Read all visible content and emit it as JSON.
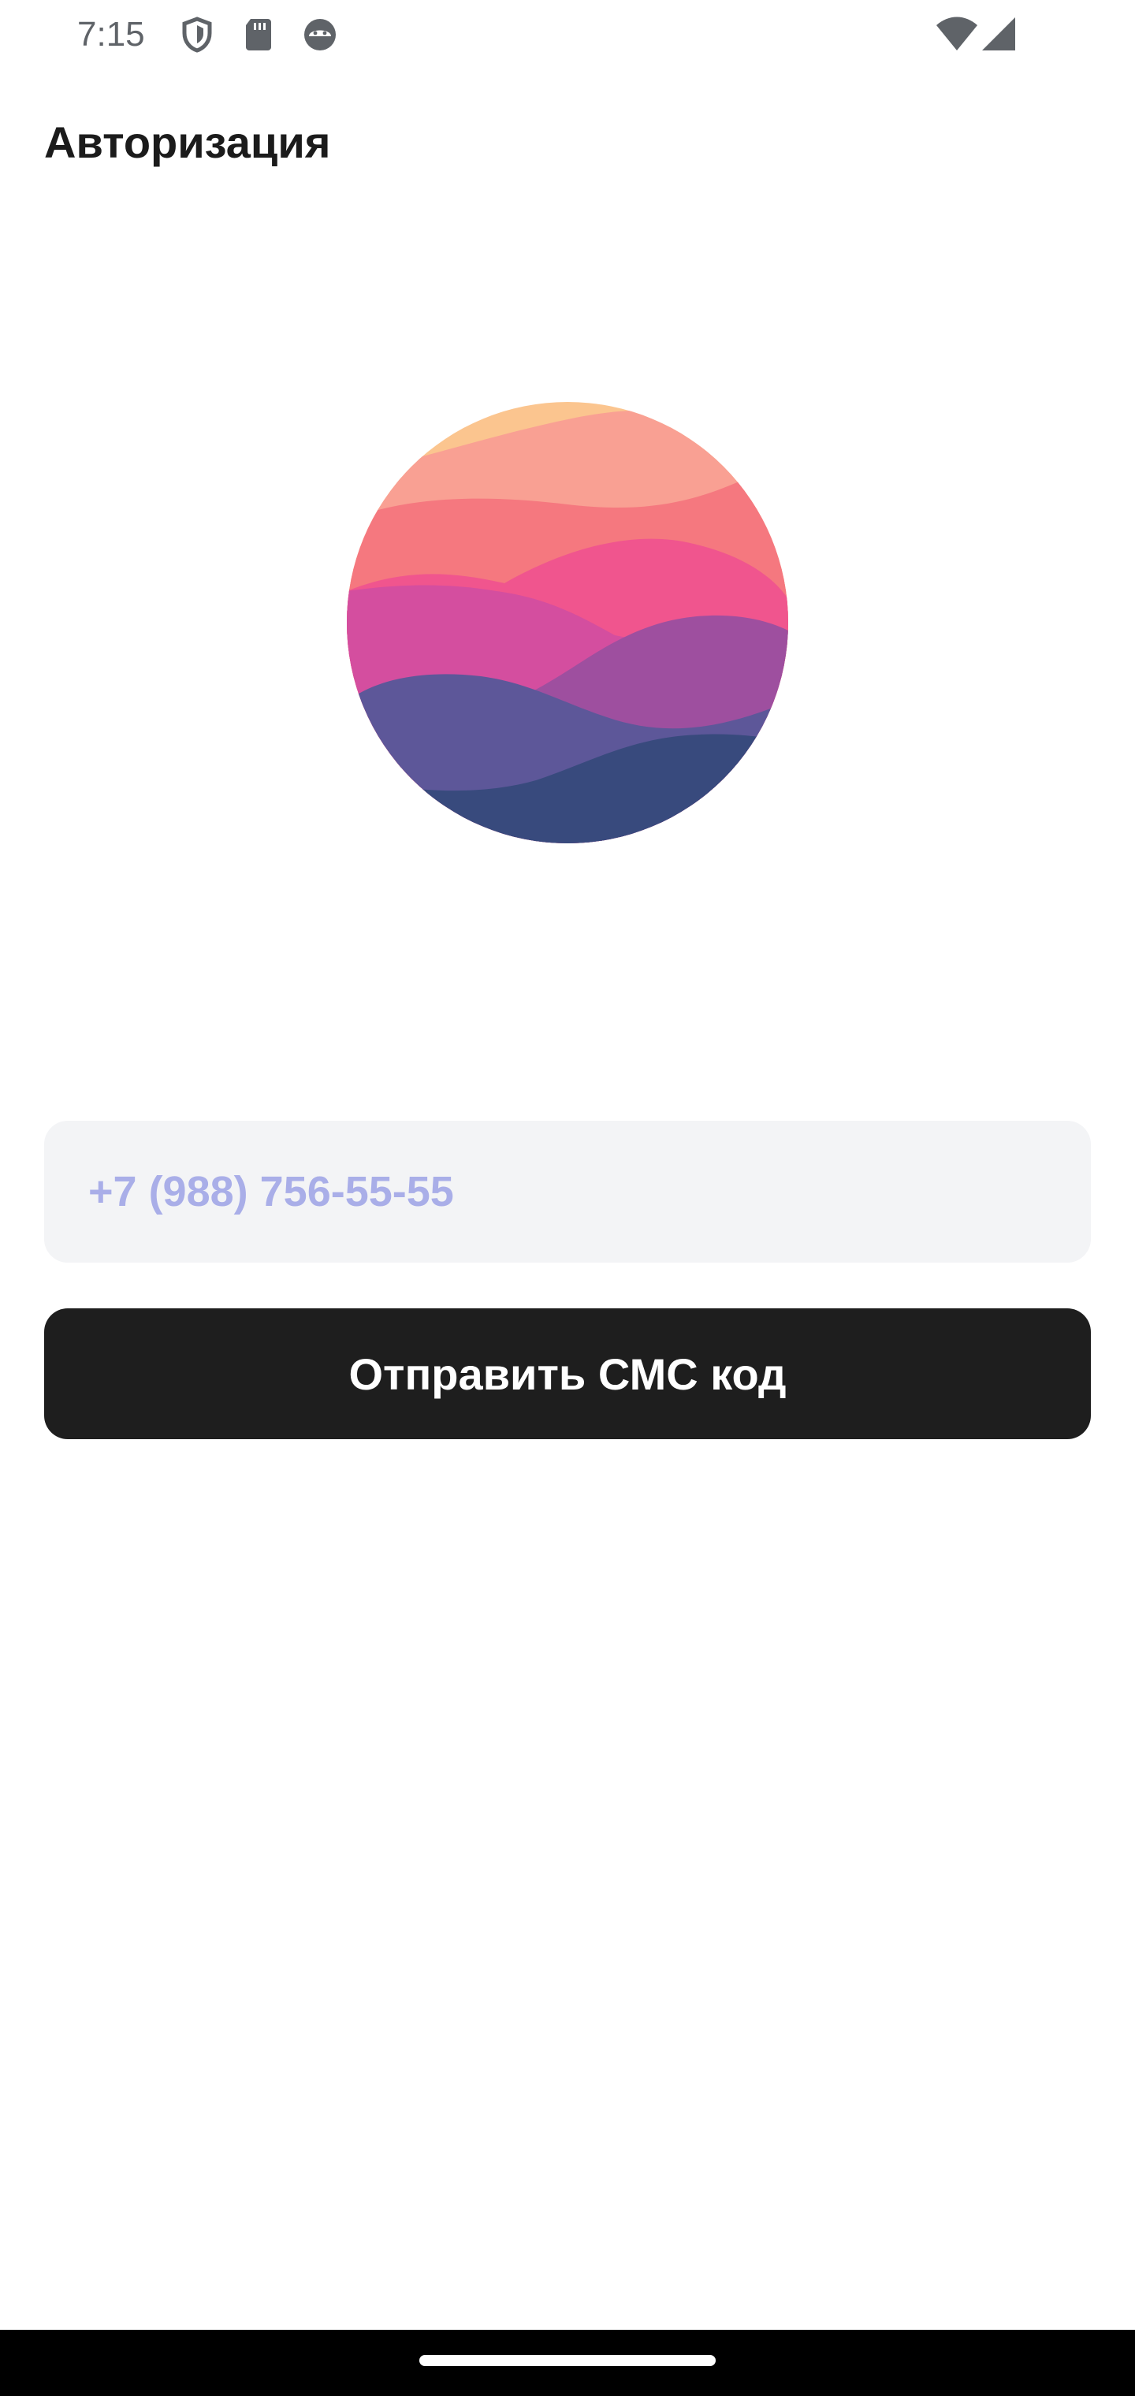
{
  "status_bar": {
    "time": "7:15",
    "left_icons": [
      "shield-icon",
      "sd-card-icon",
      "android-face-icon"
    ],
    "right_icons": [
      "wifi-icon",
      "cell-signal-icon"
    ]
  },
  "header": {
    "title": "Авторизация"
  },
  "logo": {
    "icon": "sunset-waves-logo",
    "colors": [
      "#fbc58f",
      "#f9a093",
      "#f5787f",
      "#f0558e",
      "#d44e9f",
      "#9e4f9f",
      "#5d5799",
      "#384a7d"
    ]
  },
  "phone": {
    "value": "",
    "placeholder": "+7 (988) 756-55-55"
  },
  "actions": {
    "send_sms_label": "Отправить СМС код"
  },
  "nav": {
    "home_indicator": "home-indicator"
  },
  "colors": {
    "button_bg": "#1e1e1e",
    "input_bg": "#f3f4f6",
    "placeholder": "#a9aee8"
  }
}
